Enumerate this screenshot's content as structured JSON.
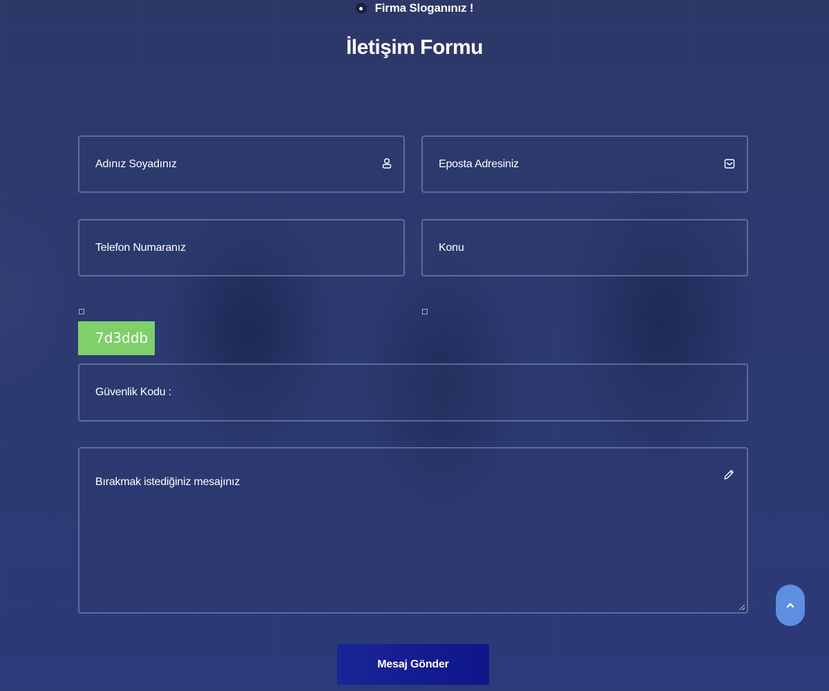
{
  "header": {
    "slogan": "Firma Sloganınız !",
    "title": "İletişim Formu"
  },
  "form": {
    "name": {
      "placeholder": "Adınız Soyadınız",
      "icon": "user-icon"
    },
    "email": {
      "placeholder": "Eposta Adresiniz",
      "icon": "envelope-check-icon"
    },
    "phone": {
      "placeholder": "Telefon Numaranız"
    },
    "subject": {
      "placeholder": "Konu"
    },
    "captcha": {
      "code": "7d3ddb",
      "placeholder": "Güvenlik Kodu :",
      "code_bg": "#7fcf6a"
    },
    "message": {
      "placeholder": "Bırakmak istediğiniz mesajınız",
      "icon": "pencil-icon"
    },
    "submit_label": "Mesaj Gönder"
  },
  "scroll_top": {
    "icon": "chevron-up-icon",
    "color": "#5e8ee0"
  },
  "colors": {
    "background": "#2c3a72",
    "button": "#121d90",
    "field_border": "#8f98c4"
  }
}
